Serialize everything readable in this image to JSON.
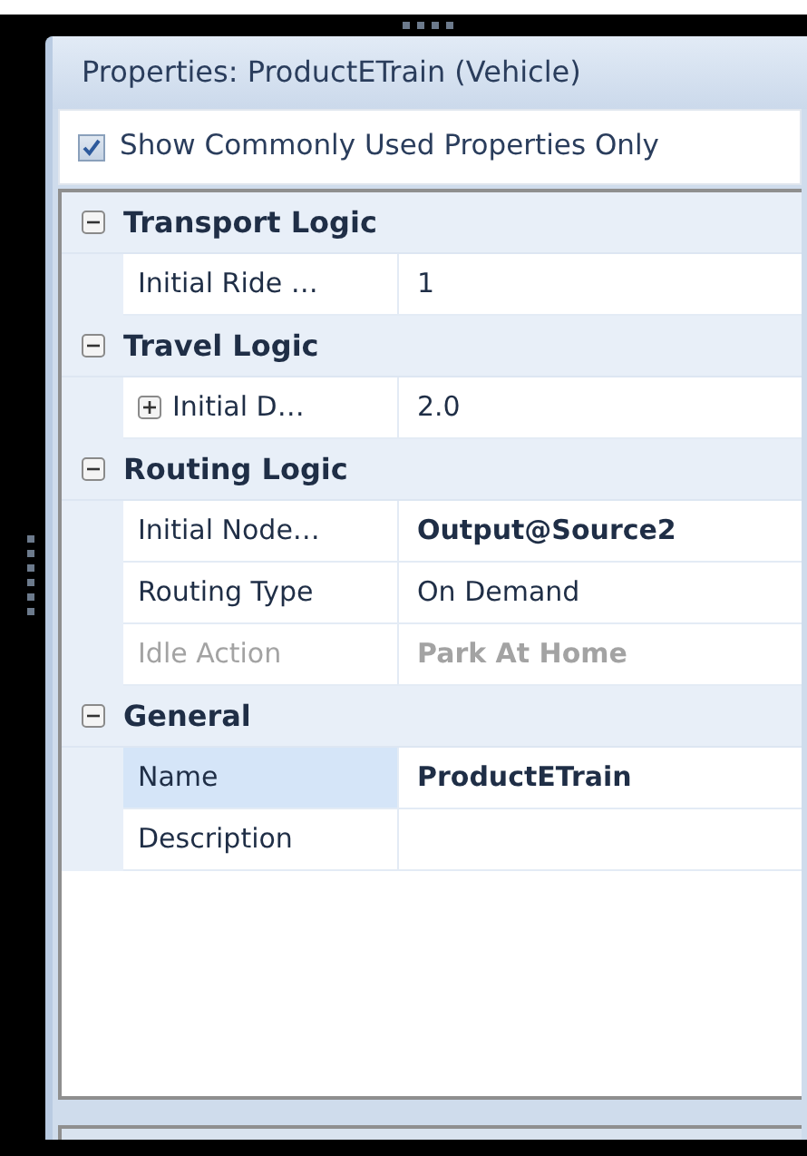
{
  "panel": {
    "title": "Properties: ProductETrain (Vehicle)"
  },
  "filter": {
    "label": "Show Commonly Used Properties Only",
    "checked": true
  },
  "categories": [
    {
      "title": "Transport Logic",
      "expanded": true,
      "rows": [
        {
          "kind": "plain",
          "label": "Initial Ride …",
          "value": "1",
          "bold": false,
          "disabled": false,
          "selected": false
        }
      ]
    },
    {
      "title": "Travel Logic",
      "expanded": true,
      "rows": [
        {
          "kind": "expandable",
          "expanded": false,
          "label": "Initial D…",
          "value": "2.0",
          "bold": false,
          "disabled": false,
          "selected": false
        }
      ]
    },
    {
      "title": "Routing Logic",
      "expanded": true,
      "rows": [
        {
          "kind": "plain",
          "label": "Initial Node…",
          "value": "Output@Source2",
          "bold": true,
          "disabled": false,
          "selected": false
        },
        {
          "kind": "plain",
          "label": "Routing Type",
          "value": "On Demand",
          "bold": false,
          "disabled": false,
          "selected": false
        },
        {
          "kind": "plain",
          "label": "Idle Action",
          "value": "Park At Home",
          "bold": true,
          "disabled": true,
          "selected": false
        }
      ]
    },
    {
      "title": "General",
      "expanded": true,
      "rows": [
        {
          "kind": "plain",
          "label": "Name",
          "value": "ProductETrain",
          "bold": true,
          "disabled": false,
          "selected": true
        },
        {
          "kind": "plain",
          "label": "Description",
          "bold": false,
          "disabled": false,
          "selected": false
        }
      ]
    }
  ]
}
